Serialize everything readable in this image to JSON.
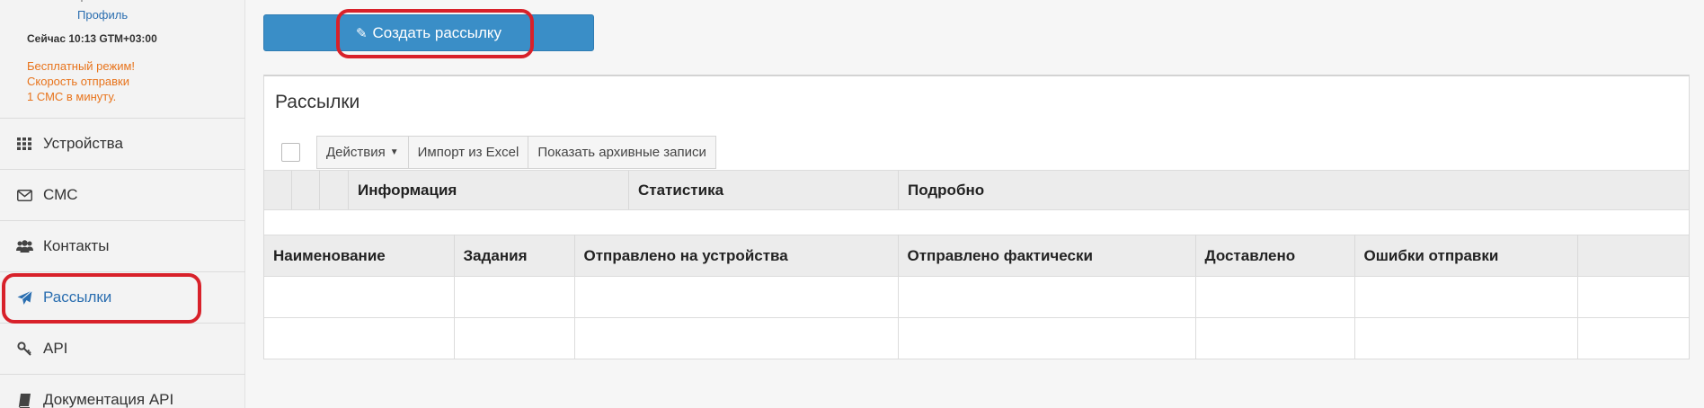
{
  "sidebar": {
    "cut_text": "т",
    "profile_link": "Профиль",
    "time": "Сейчас 10:13 GTM+03:00",
    "warning": [
      "Бесплатный режим!",
      "Скорость отправки",
      "1 СМС в минуту."
    ],
    "nav": [
      {
        "label": "Устройства",
        "icon": "grid-icon"
      },
      {
        "label": "СМС",
        "icon": "envelope-icon"
      },
      {
        "label": "Контакты",
        "icon": "users-icon"
      },
      {
        "label": "Рассылки",
        "icon": "send-icon",
        "active": true
      },
      {
        "label": "API",
        "icon": "key-icon"
      },
      {
        "label": "Документация API",
        "icon": "book-icon"
      }
    ]
  },
  "main": {
    "create_button": "Создать рассылку",
    "panel_title": "Рассылки",
    "toolbar": {
      "actions": "Действия",
      "import": "Импорт из Excel",
      "archive": "Показать архивные записи"
    },
    "group_headers": [
      "Информация",
      "Статистика",
      "Подробно"
    ],
    "columns": [
      "Наименование",
      "Задания",
      "Отправлено на устройства",
      "Отправлено фактически",
      "Доставлено",
      "Ошибки отправки"
    ]
  },
  "colors": {
    "accent": "#3a8ec7",
    "highlight": "#d8212a",
    "warning": "#e8741c",
    "link": "#2a6eb0"
  }
}
